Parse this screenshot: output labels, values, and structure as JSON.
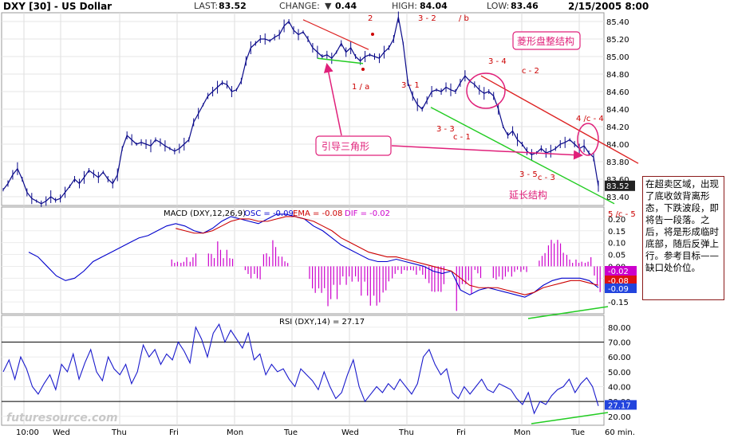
{
  "header": {
    "symbol": "DXY [30] - US Dollar",
    "last_label": "LAST:",
    "last_value": "83.52",
    "change_label": "CHANGE:",
    "change_value": "0.44",
    "high_label": "HIGH:",
    "high_value": "84.04",
    "low_label": "LOW:",
    "low_value": "83.46",
    "datetime": "2/15/2005 8:00"
  },
  "watermark": "futuresource.com",
  "annotation_note": "在超卖区域，出现了底收敛背离形态，下跌波段，即将告一段落。之后，将是形成临时底部，随后反弹上行。参考目标——缺口处价位。",
  "chart_data": [
    {
      "type": "line",
      "panel": "price",
      "title": "DXY [30] - US Dollar",
      "x_categories": [
        "10:00",
        "Wed",
        "Thu",
        "Fri",
        "Mon",
        "Tue",
        "Wed",
        "Thu",
        "Fri",
        "Mon",
        "Tue",
        "60 min."
      ],
      "ylim": [
        83.3,
        85.5
      ],
      "y_ticks": [
        "85.40",
        "85.20",
        "85.00",
        "84.80",
        "84.60",
        "84.40",
        "84.20",
        "84.00",
        "83.80",
        "83.60",
        "83.40"
      ],
      "last_price_tag": "83.52",
      "grid": true,
      "series": [
        {
          "values": [
            83.48,
            83.55,
            83.65,
            83.72,
            83.6,
            83.45,
            83.38,
            83.35,
            83.32,
            83.35,
            83.4,
            83.36,
            83.38,
            83.45,
            83.52,
            83.6,
            83.55,
            83.62,
            83.7,
            83.66,
            83.62,
            83.68,
            83.6,
            83.55,
            83.65,
            83.95,
            84.1,
            84.05,
            84.0,
            84.02,
            84.0,
            83.98,
            84.05,
            84.02,
            83.98,
            83.95,
            83.92,
            83.95,
            84.0,
            84.05,
            84.25,
            84.35,
            84.45,
            84.55,
            84.6,
            84.65,
            84.7,
            84.68,
            84.6,
            84.62,
            84.72,
            84.95,
            85.1,
            85.15,
            85.2,
            85.2,
            85.18,
            85.22,
            85.25,
            85.35,
            85.4,
            85.3,
            85.25,
            85.28,
            85.2,
            85.1,
            85.05,
            85.0,
            85.02,
            84.98,
            85.05,
            85.15,
            85.05,
            85.1,
            85.0,
            84.95,
            85.0,
            85.02,
            85.0,
            84.98,
            85.05,
            85.1,
            85.2,
            85.45,
            85.15,
            84.7,
            84.55,
            84.45,
            84.4,
            84.5,
            84.6,
            84.62,
            84.6,
            84.65,
            84.62,
            84.6,
            84.7,
            84.78,
            84.72,
            84.68,
            84.62,
            84.58,
            84.6,
            84.55,
            84.4,
            84.2,
            84.1,
            84.15,
            84.05,
            84.0,
            83.92,
            83.88,
            83.9,
            83.95,
            83.9,
            83.92,
            83.95,
            84.0,
            84.02,
            84.05,
            84.0,
            83.95,
            83.98,
            83.9,
            83.85,
            83.52
          ]
        }
      ]
    },
    {
      "type": "line",
      "panel": "macd",
      "title": "MACD (DXY,12,26,9)",
      "legend": [
        {
          "label": "OSC = -0.09",
          "color": "#0000cc"
        },
        {
          "label": "EMA = -0.08",
          "color": "#cc0000"
        },
        {
          "label": "DIF = -0.02",
          "color": "#cc00cc"
        }
      ],
      "ylim": [
        -0.2,
        0.25
      ],
      "y_ticks": [
        "0.20",
        "0.15",
        "0.10",
        "0.05",
        "0.00",
        "-0.05",
        "-0.10",
        "-0.15"
      ],
      "value_tags": [
        "-0.02",
        "-0.08",
        "-0.09"
      ],
      "series": [
        {
          "name": "OSC",
          "values": [
            0.06,
            0.04,
            0.0,
            -0.04,
            -0.06,
            -0.05,
            -0.02,
            0.02,
            0.04,
            0.06,
            0.08,
            0.1,
            0.12,
            0.13,
            0.15,
            0.17,
            0.18,
            0.17,
            0.15,
            0.14,
            0.16,
            0.19,
            0.21,
            0.2,
            0.19,
            0.18,
            0.2,
            0.22,
            0.22,
            0.21,
            0.2,
            0.17,
            0.15,
            0.12,
            0.09,
            0.07,
            0.05,
            0.03,
            0.02,
            0.02,
            0.03,
            0.02,
            0.01,
            0.0,
            -0.02,
            -0.03,
            -0.02,
            -0.1,
            -0.12,
            -0.1,
            -0.09,
            -0.1,
            -0.11,
            -0.12,
            -0.13,
            -0.11,
            -0.08,
            -0.06,
            -0.05,
            -0.05,
            -0.05,
            -0.06,
            -0.09
          ]
        },
        {
          "name": "EMA",
          "values": [
            null,
            null,
            null,
            null,
            null,
            null,
            null,
            null,
            null,
            null,
            null,
            null,
            null,
            null,
            null,
            null,
            0.16,
            0.15,
            0.14,
            0.14,
            0.15,
            0.17,
            0.19,
            0.2,
            0.2,
            0.19,
            0.19,
            0.2,
            0.21,
            0.21,
            0.2,
            0.19,
            0.17,
            0.15,
            0.12,
            0.1,
            0.08,
            0.06,
            0.05,
            0.04,
            0.04,
            0.03,
            0.02,
            0.01,
            0.0,
            -0.01,
            -0.02,
            -0.05,
            -0.08,
            -0.09,
            -0.09,
            -0.09,
            -0.1,
            -0.11,
            -0.12,
            -0.11,
            -0.09,
            -0.08,
            -0.07,
            -0.06,
            -0.06,
            -0.07,
            -0.08
          ]
        },
        {
          "name": "DIF",
          "values": [
            0,
            0,
            0,
            0,
            0,
            0,
            0,
            0,
            0,
            0,
            0,
            0,
            0,
            0,
            0,
            0,
            0.01,
            0.01,
            0.01,
            0.0,
            0.01,
            0.02,
            0.02,
            0.0,
            -0.01,
            -0.01,
            0.01,
            0.02,
            0.01,
            0.0,
            0.0,
            -0.02,
            -0.02,
            -0.03,
            -0.03,
            -0.03,
            -0.03,
            -0.03,
            -0.03,
            -0.02,
            -0.01,
            -0.01,
            -0.01,
            -0.01,
            -0.02,
            -0.02,
            0.0,
            -0.05,
            -0.04,
            -0.01,
            0.0,
            -0.01,
            -0.01,
            -0.01,
            -0.01,
            0.0,
            0.01,
            0.02,
            0.02,
            0.01,
            0.01,
            0.01,
            -0.02
          ]
        }
      ]
    },
    {
      "type": "line",
      "panel": "rsi",
      "title": "RSI (DXY,14) = 27.17",
      "ylim": [
        14,
        88
      ],
      "y_ticks": [
        "80.00",
        "70.00",
        "60.00",
        "50.00",
        "40.00",
        "30.00",
        "20.00"
      ],
      "value_tag": "27.17",
      "reference_lines": [
        70,
        30
      ],
      "series": [
        {
          "name": "RSI",
          "values": [
            50,
            58,
            45,
            60,
            52,
            40,
            35,
            42,
            48,
            38,
            55,
            50,
            62,
            45,
            56,
            65,
            50,
            44,
            60,
            52,
            48,
            55,
            42,
            50,
            68,
            60,
            65,
            55,
            62,
            58,
            70,
            64,
            56,
            80,
            72,
            60,
            76,
            82,
            70,
            78,
            72,
            66,
            76,
            58,
            62,
            48,
            55,
            50,
            52,
            45,
            40,
            52,
            48,
            44,
            38,
            50,
            40,
            32,
            36,
            48,
            58,
            40,
            30,
            35,
            40,
            36,
            42,
            38,
            45,
            40,
            35,
            42,
            60,
            65,
            55,
            48,
            52,
            36,
            32,
            40,
            35,
            40,
            45,
            38,
            36,
            42,
            40,
            38,
            32,
            28,
            36,
            22,
            30,
            28,
            34,
            38,
            40,
            45,
            36,
            42,
            46,
            40,
            27
          ]
        }
      ]
    }
  ],
  "annotations": {
    "wave_labels": [
      "2",
      "1 / a",
      "3 - 2",
      "/ b",
      "3 - 1",
      "3 - 3",
      "c - 1",
      "3 - 4",
      "c - 2",
      "4 /c - 4",
      "3 - 5",
      "c - 3",
      "5 /c - 5"
    ],
    "leading_triangle": "引导三角形",
    "diamond_consolidation": "菱形盘整结构",
    "extension_structure": "延长结构"
  },
  "colors": {
    "price_line": "#0a0a8a",
    "macd_osc": "#0000cc",
    "macd_ema": "#cc0000",
    "macd_dif": "#cc00cc",
    "rsi_line": "#1a1acc",
    "annotation_red": "#cc0000",
    "annotation_magenta": "#e0207a",
    "trend_green": "#22cc22",
    "trend_red": "#dd2222",
    "tag_blue": "#2244dd",
    "tag_red": "#dd1111",
    "tag_magenta": "#cc00cc"
  }
}
